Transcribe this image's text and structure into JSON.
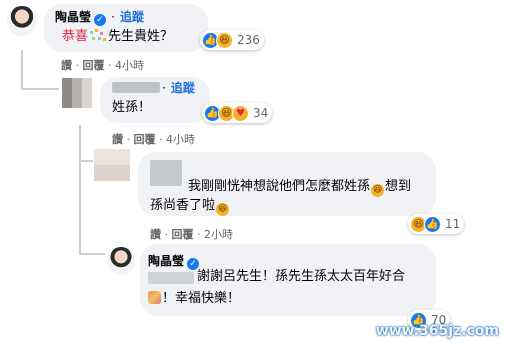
{
  "comments": [
    {
      "author": "陶晶瑩",
      "follow": "追蹤",
      "text_red": "恭喜",
      "text": "先生貴姓？",
      "reactions_count": "236",
      "actions": {
        "like": "讚",
        "reply": "回覆",
        "time": "4小時"
      }
    },
    {
      "follow": "追蹤",
      "text": "姓孫！",
      "reactions_count": "34",
      "actions": {
        "like": "讚",
        "reply": "回覆",
        "time": "4小時"
      }
    },
    {
      "text_line1_a": "我剛剛恍神想說他們怎麼都姓孫",
      "text_line1_b": "想到",
      "text_line2_a": "孫尚香了啦",
      "reactions_count": "11",
      "actions": {
        "like": "讚",
        "reply": "回覆",
        "time": "2小時"
      }
    },
    {
      "author": "陶晶瑩",
      "text_line1": "謝謝呂先生！孫先生孫太太百年好合",
      "text_line2": "！幸福快樂！",
      "reactions_count": "70"
    }
  ],
  "dot": "·",
  "verified_glyph": "✓",
  "icons": {
    "like": "like-icon",
    "haha": "haha-icon",
    "care": "care-icon",
    "party": "party-popper-icon",
    "confetti": "confetti-icon",
    "verified": "verified-icon"
  },
  "colors": {
    "follow": "#216fdb",
    "red": "#e41e3f",
    "bubble": "#f0f2f5"
  },
  "watermark": "www.365jz.com"
}
